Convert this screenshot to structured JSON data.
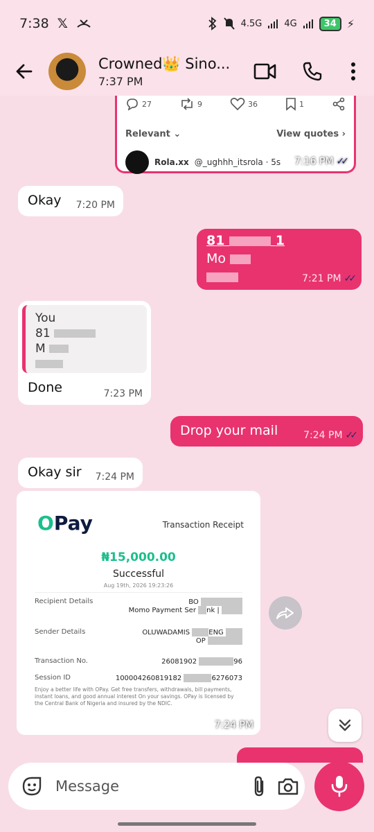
{
  "status_bar": {
    "time": "7:38",
    "network_1": "4.5G",
    "network_2": "4G",
    "battery": "34"
  },
  "header": {
    "contact_name": "Crowned👑 Sino...",
    "contact_status": "7:37 PM"
  },
  "tweet_card": {
    "replies": "27",
    "reposts": "9",
    "likes": "36",
    "bookmarks": "1",
    "sort_label": "Relevant",
    "view_quotes": "View quotes",
    "author_name": "Rola.xx",
    "author_handle": "@_ughhh_itsrola · 5s",
    "time": "7:16 PM"
  },
  "messages": {
    "m1": {
      "text": "Okay",
      "time": "7:20 PM"
    },
    "m2": {
      "line1": "81",
      "line1b": "1",
      "line2": "Mo",
      "time": "7:21 PM"
    },
    "m3": {
      "quote_author": "You",
      "quote_line1": "81",
      "quote_line2": "M",
      "text": "Done",
      "time": "7:23 PM"
    },
    "m4": {
      "text": "Drop your mail",
      "time": "7:24 PM"
    },
    "m5": {
      "text": "Okay sir",
      "time": "7:24 PM"
    },
    "m6": {
      "time": "7:24 PM"
    }
  },
  "receipt": {
    "logo_o": "O",
    "logo_rest": "Pay",
    "title": "Transaction Receipt",
    "amount": "₦15,000.00",
    "status": "Successful",
    "date": "Aug 19th, 2026 19:23:26",
    "rows": [
      {
        "label": "Recipient Details",
        "value": "BO",
        "value2": "Momo Payment Ser",
        "value2b": "nk |"
      },
      {
        "label": "Sender Details",
        "value": "OLUWADAMIS",
        "value2": "ENG",
        "value3": "OP"
      },
      {
        "label": "Transaction No.",
        "value": "26081902",
        "value_end": "96"
      },
      {
        "label": "Session ID",
        "value": "100004260819182",
        "value_end": "6276073"
      }
    ],
    "footer": "Enjoy a better life with OPay. Get free transfers, withdrawals, bill payments, instant loans, and good annual interest On your savings. OPay is licensed by the Central Bank of Nigeria and insured by the NDIC."
  },
  "composer": {
    "placeholder": "Message"
  },
  "colors": {
    "accent": "#e8336f",
    "background": "#f8dde7",
    "opay_green": "#1bbf8c"
  }
}
